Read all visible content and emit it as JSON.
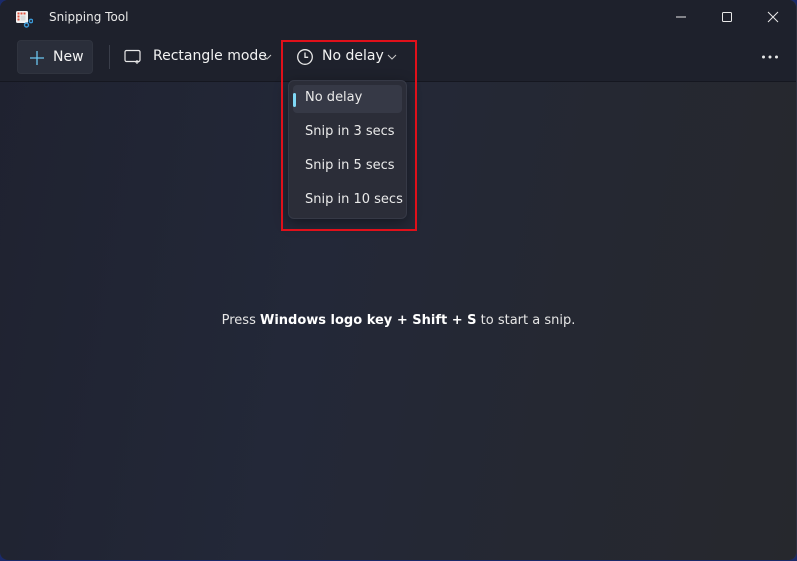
{
  "window": {
    "title": "Snipping Tool",
    "controls": [
      "minimize",
      "maximize",
      "close"
    ]
  },
  "toolbar": {
    "new_label": "New",
    "mode_label": "Rectangle mode",
    "delay_label": "No delay",
    "more_label": "See more"
  },
  "delay_menu": {
    "items": [
      {
        "label": "No delay",
        "selected": true
      },
      {
        "label": "Snip in 3 secs",
        "selected": false
      },
      {
        "label": "Snip in 5 secs",
        "selected": false
      },
      {
        "label": "Snip in 10 secs",
        "selected": false
      }
    ]
  },
  "hint": {
    "prefix": "Press ",
    "key1": "Windows logo key",
    "plus1": " + ",
    "key2": "Shift",
    "plus2": " + ",
    "key3": "S",
    "suffix": " to start a snip."
  },
  "colors": {
    "accent": "#7fd8f5",
    "highlight_border": "#e0101a"
  }
}
